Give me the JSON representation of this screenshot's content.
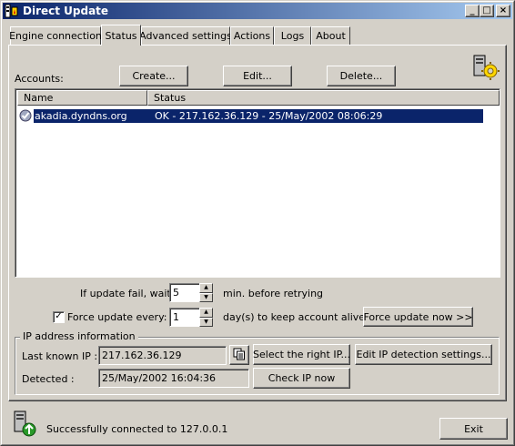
{
  "window": {
    "title": "Direct Update",
    "controls": {
      "minimize": "_",
      "maximize": "□",
      "close": "×"
    }
  },
  "tabs": [
    {
      "label": "Engine connection"
    },
    {
      "label": "Status",
      "active": true
    },
    {
      "label": "Advanced settings"
    },
    {
      "label": "Actions"
    },
    {
      "label": "Logs"
    },
    {
      "label": "About"
    }
  ],
  "accounts": {
    "label": "Accounts:",
    "create_label": "Create...",
    "edit_label": "Edit...",
    "delete_label": "Delete...",
    "columns": [
      "Name",
      "Status"
    ],
    "rows": [
      {
        "name": "akadia.dyndns.org",
        "status": "OK - 217.162.36.129 - 25/May/2002 08:06:29",
        "selected": true,
        "icon": "check-circle-icon"
      }
    ]
  },
  "retry": {
    "prefix": "If update fail, wait",
    "value": "5",
    "suffix": "min.  before retrying"
  },
  "force": {
    "checked": true,
    "label": "Force update every:",
    "value": "1",
    "suffix": "day(s) to keep account alive",
    "button_label": "Force update now >>"
  },
  "ip": {
    "group_label": "IP address information",
    "last_known_label": "Last known IP :",
    "last_known_value": "217.162.36.129",
    "detected_label": "Detected :",
    "detected_value": "25/May/2002 16:04:36",
    "select_ip_label": "Select the right IP...",
    "edit_detection_label": "Edit IP detection settings...",
    "check_ip_label": "Check IP now",
    "copy_icon": "copy-icon"
  },
  "status_bar": {
    "message": "Successfully connected to 127.0.0.1",
    "exit_label": "Exit",
    "icon": "server-connected-icon"
  },
  "colors": {
    "title_gradient_start": "#0a246a",
    "title_gradient_end": "#a6caf0",
    "selection": "#0a246a",
    "face": "#d4d0c8"
  }
}
